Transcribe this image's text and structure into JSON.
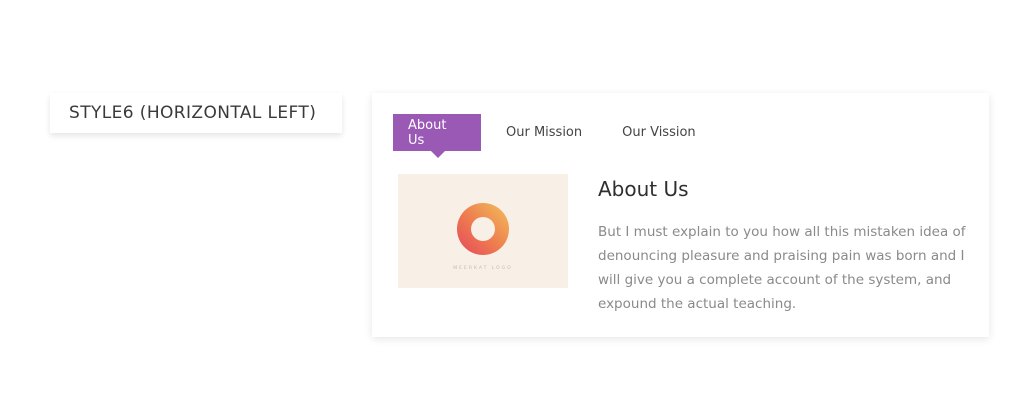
{
  "style_label": {
    "text": "STYLE6 (HORIZONTAL LEFT)"
  },
  "tabs": [
    {
      "label": "About Us",
      "active": true
    },
    {
      "label": "Our Mission",
      "active": false
    },
    {
      "label": "Our Vission",
      "active": false
    }
  ],
  "content": {
    "image": {
      "icon": "donut-logo-icon",
      "caption": "MEERKAT LOGO"
    },
    "heading": "About Us",
    "paragraph": "But I must explain to you how all this mistaken idea of denouncing pleasure and praising pain was born and I will give you a complete account of the system, and expound the actual teaching."
  },
  "colors": {
    "accent": "#9b59b6",
    "image_background": "#f8efe7",
    "logo_gradient_start": "#f2c05a",
    "logo_gradient_end": "#e5475c"
  }
}
